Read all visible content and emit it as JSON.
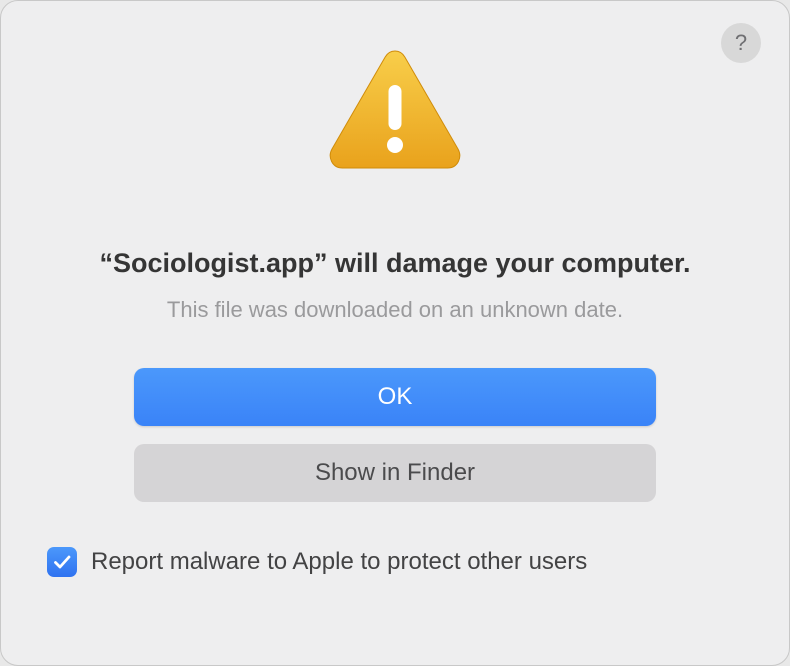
{
  "dialog": {
    "title": "“Sociologist.app” will damage your computer.",
    "subtitle": "This file was downloaded on an unknown date.",
    "primaryButton": "OK",
    "secondaryButton": "Show in Finder",
    "checkboxLabel": "Report malware to Apple to protect other users",
    "checkboxChecked": true,
    "helpAria": "Help"
  }
}
